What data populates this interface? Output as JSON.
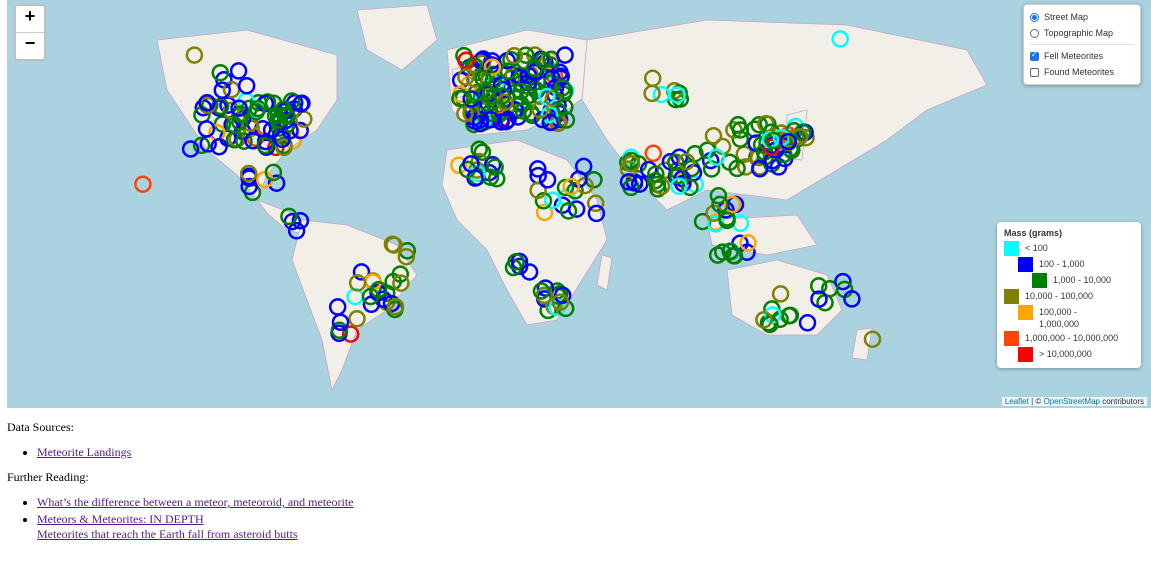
{
  "map": {
    "zoom_in": "+",
    "zoom_out": "−",
    "layers": {
      "base": [
        {
          "label": "Street Map",
          "selected": true
        },
        {
          "label": "Topographic Map",
          "selected": false
        }
      ],
      "overlays": [
        {
          "label": "Fell Meteorites",
          "checked": true
        },
        {
          "label": "Found Meteorites",
          "checked": false
        }
      ]
    },
    "legend": {
      "title": "Mass (grams)",
      "items": [
        {
          "label": "< 100",
          "color": "#00ffff"
        },
        {
          "label": "100 - 1,000",
          "color": "#0000ff"
        },
        {
          "label": "1,000 - 10,000",
          "color": "#008000"
        },
        {
          "label": "10,000 - 100,000",
          "color": "#808000"
        },
        {
          "label": "100,000 - 1,000,000",
          "color": "#ffa500"
        },
        {
          "label": "1,000,000 - 10,000,000",
          "color": "#ff4500"
        },
        {
          "label": "> 10,000,000",
          "color": "#ff0000"
        }
      ]
    },
    "attribution": {
      "leaflet": "Leaflet",
      "sep": " | © ",
      "osm": "OpenStreetMap",
      "suffix": " contributors"
    },
    "colors": {
      "water": "#aad3df",
      "land": "#f2efe9",
      "border": "#c8a4c8"
    }
  },
  "content": {
    "sources_heading": "Data Sources:",
    "sources": [
      "Meteorite Landings"
    ],
    "reading_heading": "Further Reading:",
    "reading": [
      "What’s the difference between a meteor, meteoroid, and meteorite",
      "Meteors & Meteorites: IN DEPTH"
    ],
    "reading_sub": "Meteorites that reach the Earth fall from asteroid butts"
  }
}
